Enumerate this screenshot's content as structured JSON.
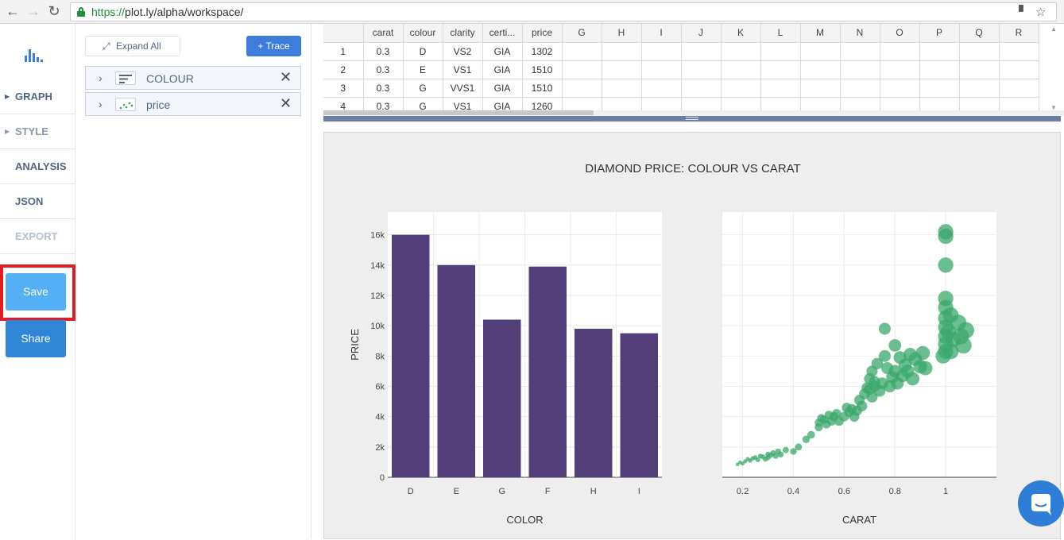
{
  "browser": {
    "url_protocol": "https://",
    "url_rest": "plot.ly/alpha/workspace/",
    "icons": [
      "back-arrow-icon",
      "forward-arrow-icon",
      "reload-icon",
      "lock-icon",
      "bookmark-icon",
      "star-icon"
    ]
  },
  "leftnav": {
    "items": [
      {
        "label": "GRAPH"
      },
      {
        "label": "STYLE"
      },
      {
        "label": "ANALYSIS"
      },
      {
        "label": "JSON"
      },
      {
        "label": "EXPORT"
      }
    ],
    "save_label": "Save",
    "share_label": "Share",
    "colors": {
      "save": "#54b0f5",
      "share": "#2f86d6",
      "highlight": "#e31b23"
    }
  },
  "panel": {
    "expand_label": "Expand All",
    "trace_label": "+ Trace",
    "traces": [
      {
        "label": "COLOUR",
        "icon": "bar-chart-icon"
      },
      {
        "label": "price",
        "icon": "scatter-icon"
      }
    ]
  },
  "grid": {
    "headers": [
      "",
      "carat",
      "colour",
      "clarity",
      "certi...",
      "price",
      "G",
      "H",
      "I",
      "J",
      "K",
      "L",
      "M",
      "N",
      "O",
      "P",
      "Q",
      "R"
    ],
    "rows": [
      [
        "1",
        "0.3",
        "D",
        "VS2",
        "GIA",
        "1302"
      ],
      [
        "2",
        "0.3",
        "E",
        "VS1",
        "GIA",
        "1510"
      ],
      [
        "3",
        "0.3",
        "G",
        "VVS1",
        "GIA",
        "1510"
      ],
      [
        "4",
        "0.3",
        "G",
        "VS1",
        "GIA",
        "1260"
      ]
    ]
  },
  "chart_data": [
    {
      "type": "bar",
      "title": "DIAMOND PRICE: COLOUR VS CARAT",
      "xlabel": "COLOR",
      "ylabel": "PRICE",
      "categories": [
        "D",
        "E",
        "G",
        "F",
        "H",
        "I"
      ],
      "values": [
        16000,
        14000,
        10400,
        13900,
        9800,
        9500
      ],
      "ylim": [
        0,
        17500
      ],
      "yticks": [
        "0",
        "2k",
        "4k",
        "6k",
        "8k",
        "10k",
        "12k",
        "14k",
        "16k"
      ],
      "color": "#523f7a",
      "grid": true
    },
    {
      "type": "scatter",
      "xlabel": "CARAT",
      "xlim": [
        0.12,
        1.2
      ],
      "ylim": [
        0,
        17500
      ],
      "xticks": [
        "0.2",
        "0.4",
        "0.6",
        "0.8",
        "1"
      ],
      "color": "#3aa86b",
      "grid": true,
      "points": [
        [
          0.18,
          850
        ],
        [
          0.19,
          980
        ],
        [
          0.2,
          900
        ],
        [
          0.21,
          1050
        ],
        [
          0.22,
          1200
        ],
        [
          0.23,
          1100
        ],
        [
          0.24,
          1250
        ],
        [
          0.25,
          1300
        ],
        [
          0.26,
          1150
        ],
        [
          0.27,
          1400
        ],
        [
          0.28,
          1350
        ],
        [
          0.29,
          1200
        ],
        [
          0.3,
          1300
        ],
        [
          0.3,
          1510
        ],
        [
          0.31,
          1450
        ],
        [
          0.32,
          1600
        ],
        [
          0.33,
          1400
        ],
        [
          0.34,
          1700
        ],
        [
          0.35,
          1500
        ],
        [
          0.37,
          1800
        ],
        [
          0.4,
          1700
        ],
        [
          0.42,
          2000
        ],
        [
          0.45,
          2500
        ],
        [
          0.47,
          2800
        ],
        [
          0.5,
          3300
        ],
        [
          0.5,
          3600
        ],
        [
          0.51,
          3900
        ],
        [
          0.52,
          3800
        ],
        [
          0.53,
          3500
        ],
        [
          0.54,
          4100
        ],
        [
          0.55,
          3700
        ],
        [
          0.56,
          4000
        ],
        [
          0.57,
          4200
        ],
        [
          0.58,
          3700
        ],
        [
          0.6,
          4000
        ],
        [
          0.61,
          4600
        ],
        [
          0.62,
          4300
        ],
        [
          0.63,
          4500
        ],
        [
          0.64,
          4000
        ],
        [
          0.65,
          4400
        ],
        [
          0.66,
          5100
        ],
        [
          0.67,
          4700
        ],
        [
          0.68,
          5500
        ],
        [
          0.7,
          6500
        ],
        [
          0.7,
          5800
        ],
        [
          0.71,
          5300
        ],
        [
          0.71,
          7000
        ],
        [
          0.72,
          6000
        ],
        [
          0.73,
          7500
        ],
        [
          0.74,
          5700
        ],
        [
          0.75,
          6200
        ],
        [
          0.76,
          8000
        ],
        [
          0.77,
          7200
        ],
        [
          0.78,
          6000
        ],
        [
          0.79,
          6600
        ],
        [
          0.8,
          7000
        ],
        [
          0.8,
          8700
        ],
        [
          0.81,
          6200
        ],
        [
          0.82,
          7900
        ],
        [
          0.83,
          6700
        ],
        [
          0.84,
          7400
        ],
        [
          0.85,
          7000
        ],
        [
          0.86,
          8100
        ],
        [
          0.87,
          6500
        ],
        [
          0.88,
          7800
        ],
        [
          0.9,
          7300
        ],
        [
          0.91,
          8200
        ],
        [
          0.92,
          7200
        ],
        [
          0.76,
          9800
        ],
        [
          0.99,
          8000
        ],
        [
          1.0,
          8300
        ],
        [
          1.0,
          8800
        ],
        [
          1.0,
          9300
        ],
        [
          1.0,
          9900
        ],
        [
          1.0,
          10500
        ],
        [
          1.0,
          11200
        ],
        [
          1.0,
          11800
        ],
        [
          1.0,
          14000
        ],
        [
          1.0,
          15900
        ],
        [
          1.0,
          16200
        ],
        [
          1.01,
          9600
        ],
        [
          1.02,
          10700
        ],
        [
          1.03,
          9100
        ],
        [
          1.05,
          10200
        ],
        [
          1.06,
          9300
        ],
        [
          1.07,
          8700
        ],
        [
          1.08,
          9700
        ],
        [
          1.02,
          8300
        ],
        [
          0.69,
          5900
        ],
        [
          0.72,
          6300
        ]
      ]
    }
  ]
}
